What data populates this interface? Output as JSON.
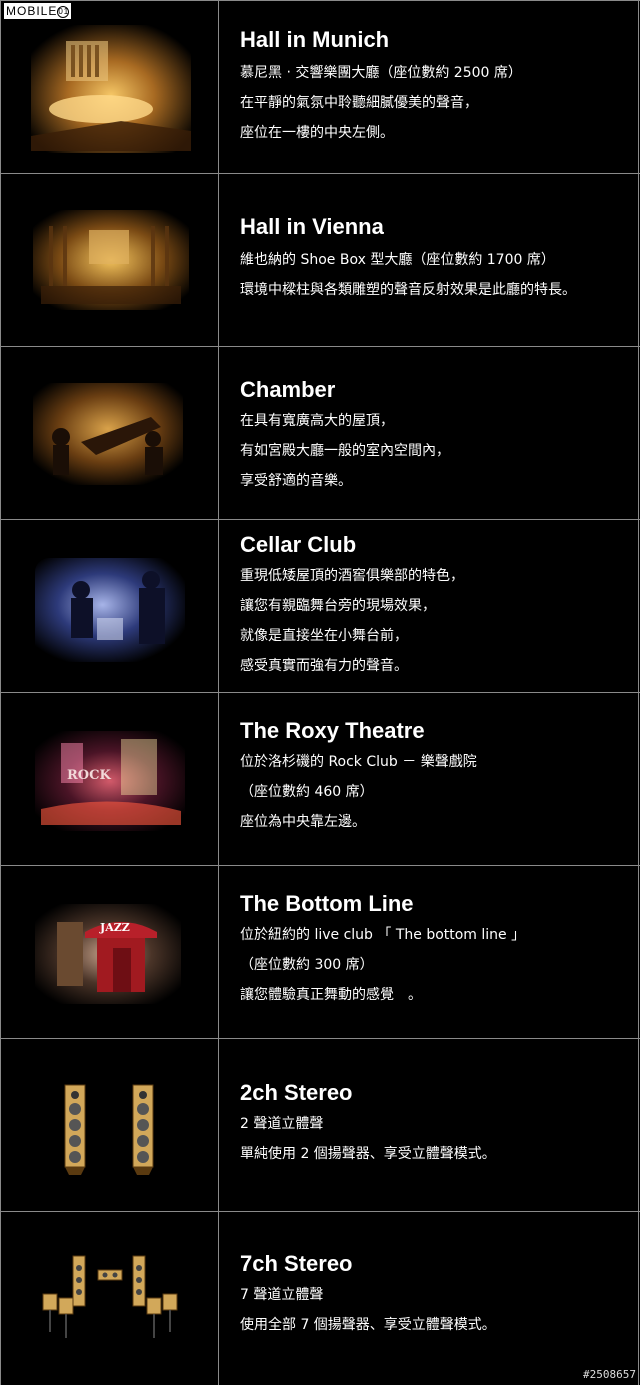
{
  "logo": {
    "text": "MOBILE",
    "suffix": "01"
  },
  "watermark": "#2508657",
  "modes": [
    {
      "title": "Hall in Munich",
      "lines": [
        "慕尼黑 ‧ 交響樂團大廳（座位數約 2500 席）",
        "在平靜的氣氛中聆聽細膩優美的聲音，",
        "座位在一樓的中央左側。"
      ]
    },
    {
      "title": "Hall in Vienna",
      "lines": [
        "維也納的 Shoe Box 型大廳（座位數約 1700 席）",
        "環境中樑柱與各類雕塑的聲音反射效果是此廳的特長。"
      ]
    },
    {
      "title": "Chamber",
      "lines": [
        "在具有寬廣高大的屋頂，",
        "有如宮殿大廳一般的室內空間內，",
        "享受舒適的音樂。"
      ]
    },
    {
      "title": "Cellar Club",
      "lines": [
        "重現低矮屋頂的酒窖俱樂部的特色，",
        "讓您有親臨舞台旁的現場效果，",
        "就像是直接坐在小舞台前，",
        "感受真實而強有力的聲音。"
      ]
    },
    {
      "title": "The Roxy Theatre",
      "lines": [
        "位於洛杉磯的 Rock Club － 樂聲戲院",
        "（座位數約 460 席）",
        "座位為中央靠左邊。"
      ],
      "sign": "ROCK"
    },
    {
      "title": "The Bottom Line",
      "lines": [
        "位於紐約的 live club 「 The bottom line 」",
        "（座位數約 300 席）",
        "讓您體驗真正舞動的感覺　。"
      ],
      "sign": "JAZZ"
    },
    {
      "title": "2ch Stereo",
      "lines": [
        "2 聲道立體聲",
        "單純使用 2 個揚聲器、享受立體聲模式。"
      ]
    },
    {
      "title": "7ch Stereo",
      "lines": [
        "7 聲道立體聲",
        "使用全部 7 個揚聲器、享受立體聲模式。"
      ]
    }
  ]
}
